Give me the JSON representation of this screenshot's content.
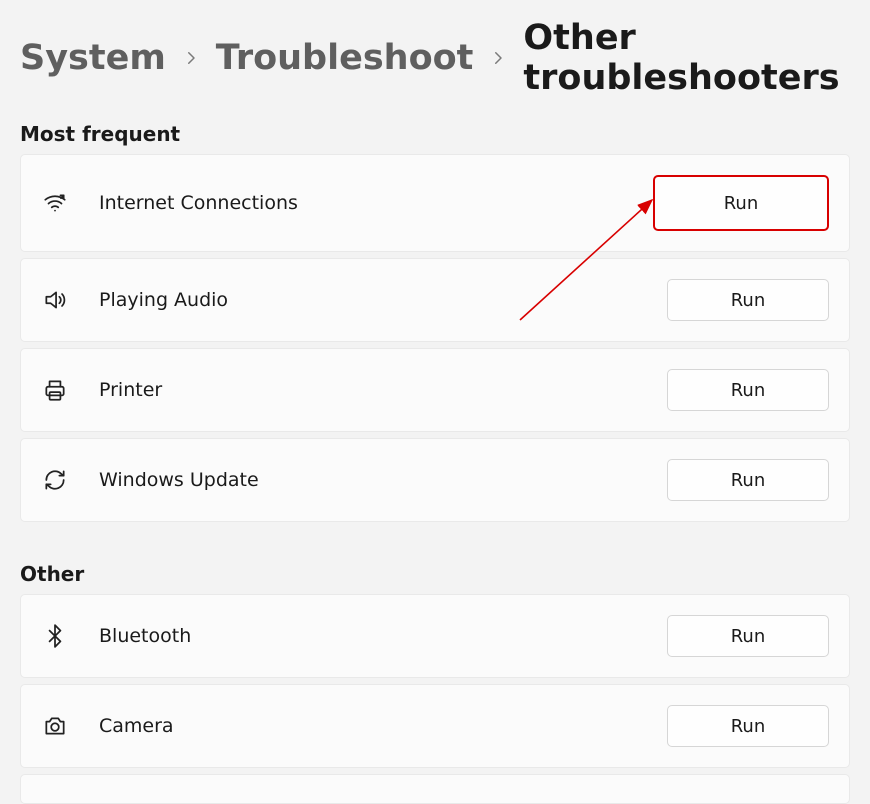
{
  "breadcrumb": {
    "system": "System",
    "troubleshoot": "Troubleshoot",
    "current": "Other troubleshooters"
  },
  "sections": {
    "most_frequent_title": "Most frequent",
    "other_title": "Other",
    "button_label": "Run",
    "items_most_frequent": [
      {
        "label": "Internet Connections"
      },
      {
        "label": "Playing Audio"
      },
      {
        "label": "Printer"
      },
      {
        "label": "Windows Update"
      }
    ],
    "items_other": [
      {
        "label": "Bluetooth"
      },
      {
        "label": "Camera"
      }
    ]
  },
  "annotation": {
    "highlight_color": "#d80000"
  }
}
